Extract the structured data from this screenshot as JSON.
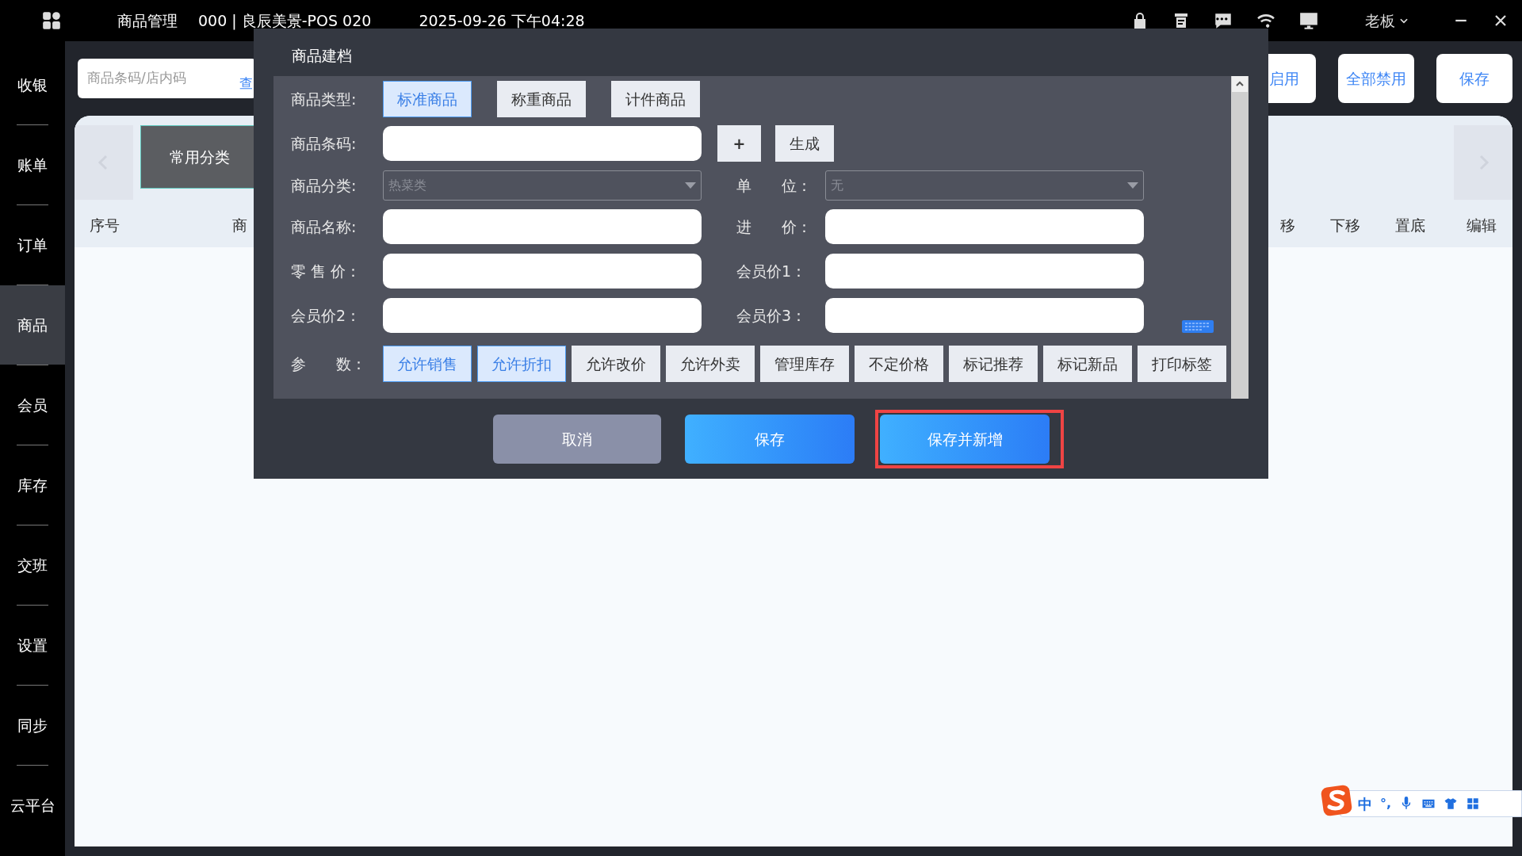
{
  "top_bar": {
    "title": "商品管理",
    "store": "000 | 良辰美景-POS 020",
    "datetime": "2025-09-26 下午04:28",
    "user": "老板"
  },
  "sidebar": {
    "items": [
      {
        "label": "收银",
        "selected": false
      },
      {
        "label": "账单",
        "selected": false
      },
      {
        "label": "订单",
        "selected": false
      },
      {
        "label": "商品",
        "selected": true
      },
      {
        "label": "会员",
        "selected": false
      },
      {
        "label": "库存",
        "selected": false
      },
      {
        "label": "交班",
        "selected": false
      },
      {
        "label": "设置",
        "selected": false
      },
      {
        "label": "同步",
        "selected": false
      },
      {
        "label": "云平台",
        "selected": false
      }
    ]
  },
  "search": {
    "placeholder": "商品条码/店内码",
    "button": "查"
  },
  "toolbar_buttons": [
    "启用",
    "全部禁用",
    "保存"
  ],
  "category_tabs": [
    {
      "label": "常用分类",
      "selected": true
    }
  ],
  "table": {
    "columns_left": [
      "序号",
      "商"
    ],
    "columns_right": [
      "移",
      "下移",
      "置底",
      "编辑"
    ]
  },
  "dialog": {
    "title": "商品建档",
    "type_label": "商品类型:",
    "types": [
      {
        "label": "标准商品",
        "selected": true
      },
      {
        "label": "称重商品",
        "selected": false
      },
      {
        "label": "计件商品",
        "selected": false
      }
    ],
    "barcode": {
      "label": "商品条码:",
      "buttons": [
        "+",
        "生成"
      ]
    },
    "category": {
      "label": "商品分类:",
      "value": "热菜类"
    },
    "unit": {
      "label": "单　　位：",
      "value": "无"
    },
    "inputs": [
      {
        "label": "商品名称:"
      },
      {
        "label": "进　　价："
      },
      {
        "label": "零 售 价："
      },
      {
        "label": "会员价1："
      },
      {
        "label": "会员价2："
      },
      {
        "label": "会员价3："
      }
    ],
    "params_label": "参　　数：",
    "params": [
      {
        "label": "允许销售",
        "checked": true
      },
      {
        "label": "允许折扣",
        "checked": true
      },
      {
        "label": "允许改价",
        "checked": false
      },
      {
        "label": "允许外卖",
        "checked": false
      },
      {
        "label": "管理库存",
        "checked": false
      },
      {
        "label": "不定价格",
        "checked": false
      },
      {
        "label": "标记推荐",
        "checked": false
      },
      {
        "label": "标记新品",
        "checked": false
      },
      {
        "label": "打印标签",
        "checked": false
      }
    ],
    "footer_buttons": [
      {
        "kind": "cancel",
        "label": "取消",
        "focused": false
      },
      {
        "kind": "primary",
        "label": "保存",
        "focused": false
      },
      {
        "kind": "primary",
        "label": "保存并新增",
        "focused": true
      }
    ]
  },
  "ime": {
    "items": [
      "中",
      "°,"
    ]
  }
}
